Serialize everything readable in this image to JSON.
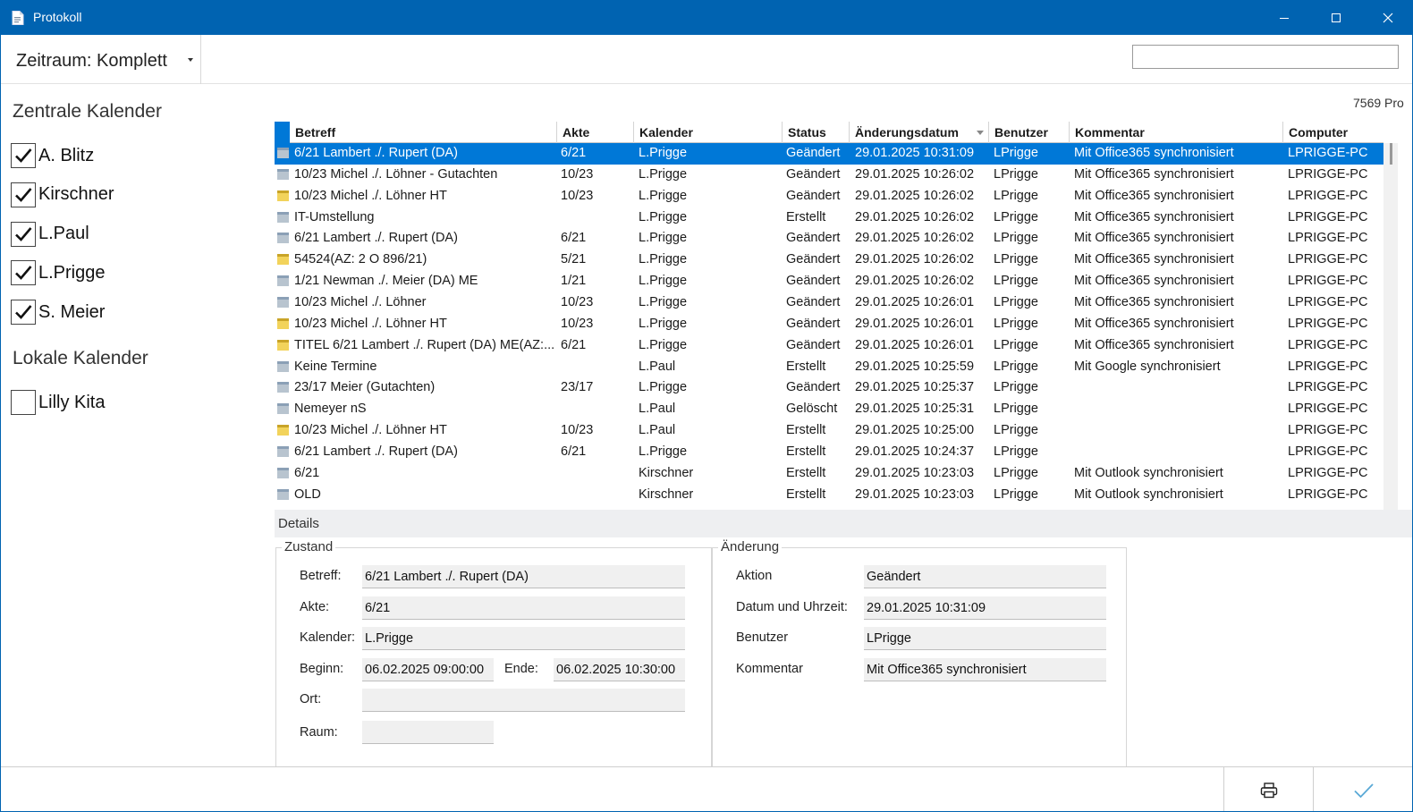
{
  "window": {
    "title": "Protokoll"
  },
  "toolbar": {
    "zeitraum_label": "Zeitraum: Komplett",
    "search_value": "",
    "search_placeholder": ""
  },
  "sidebar": {
    "central_title": "Zentrale Kalender",
    "central": [
      {
        "label": "A. Blitz",
        "checked": true
      },
      {
        "label": "Kirschner",
        "checked": true
      },
      {
        "label": "L.Paul",
        "checked": true
      },
      {
        "label": "L.Prigge",
        "checked": true
      },
      {
        "label": "S. Meier",
        "checked": true
      }
    ],
    "local_title": "Lokale Kalender",
    "local": [
      {
        "label": "Lilly Kita",
        "checked": false
      }
    ]
  },
  "grid": {
    "count_text": "7569 Pro",
    "columns": [
      "Betreff",
      "Akte",
      "Kalender",
      "Status",
      "Änderungsdatum",
      "Benutzer",
      "Kommentar",
      "Computer"
    ],
    "sorted_column": "Änderungsdatum",
    "rows": [
      {
        "icon": "calendar-gray-icon",
        "betreff": "6/21 Lambert ./. Rupert (DA)",
        "akte": "6/21",
        "kalender": "L.Prigge",
        "status": "Geändert",
        "datum": "29.01.2025 10:31:09",
        "benutzer": "LPrigge",
        "kommentar": "Mit Office365 synchronisiert",
        "computer": "LPRIGGE-PC",
        "selected": true
      },
      {
        "icon": "calendar-gray-icon",
        "betreff": "10/23 Michel ./. Löhner - Gutachten",
        "akte": "10/23",
        "kalender": "L.Prigge",
        "status": "Geändert",
        "datum": "29.01.2025 10:26:02",
        "benutzer": "LPrigge",
        "kommentar": "Mit Office365 synchronisiert",
        "computer": "LPRIGGE-PC"
      },
      {
        "icon": "calendar-yellow-icon",
        "betreff": "10/23 Michel ./. Löhner HT",
        "akte": "10/23",
        "kalender": "L.Prigge",
        "status": "Geändert",
        "datum": "29.01.2025 10:26:02",
        "benutzer": "LPrigge",
        "kommentar": "Mit Office365 synchronisiert",
        "computer": "LPRIGGE-PC"
      },
      {
        "icon": "calendar-gray-icon",
        "betreff": "IT-Umstellung",
        "akte": "",
        "kalender": "L.Prigge",
        "status": "Erstellt",
        "datum": "29.01.2025 10:26:02",
        "benutzer": "LPrigge",
        "kommentar": "Mit Office365 synchronisiert",
        "computer": "LPRIGGE-PC"
      },
      {
        "icon": "calendar-gray-icon",
        "betreff": "6/21 Lambert ./. Rupert (DA)",
        "akte": "6/21",
        "kalender": "L.Prigge",
        "status": "Geändert",
        "datum": "29.01.2025 10:26:02",
        "benutzer": "LPrigge",
        "kommentar": "Mit Office365 synchronisiert",
        "computer": "LPRIGGE-PC"
      },
      {
        "icon": "calendar-yellow-icon",
        "betreff": "54524(AZ: 2 O 896/21)",
        "akte": "5/21",
        "kalender": "L.Prigge",
        "status": "Geändert",
        "datum": "29.01.2025 10:26:02",
        "benutzer": "LPrigge",
        "kommentar": "Mit Office365 synchronisiert",
        "computer": "LPRIGGE-PC"
      },
      {
        "icon": "calendar-gray-icon",
        "betreff": "1/21 Newman ./. Meier (DA) ME",
        "akte": "1/21",
        "kalender": "L.Prigge",
        "status": "Geändert",
        "datum": "29.01.2025 10:26:02",
        "benutzer": "LPrigge",
        "kommentar": "Mit Office365 synchronisiert",
        "computer": "LPRIGGE-PC"
      },
      {
        "icon": "calendar-gray-icon",
        "betreff": "10/23 Michel ./. Löhner",
        "akte": "10/23",
        "kalender": "L.Prigge",
        "status": "Geändert",
        "datum": "29.01.2025 10:26:01",
        "benutzer": "LPrigge",
        "kommentar": "Mit Office365 synchronisiert",
        "computer": "LPRIGGE-PC"
      },
      {
        "icon": "calendar-yellow-icon",
        "betreff": "10/23 Michel ./. Löhner HT",
        "akte": "10/23",
        "kalender": "L.Prigge",
        "status": "Geändert",
        "datum": "29.01.2025 10:26:01",
        "benutzer": "LPrigge",
        "kommentar": "Mit Office365 synchronisiert",
        "computer": "LPRIGGE-PC"
      },
      {
        "icon": "calendar-yellow-icon",
        "betreff": "TITEL 6/21 Lambert ./. Rupert (DA) ME(AZ:...",
        "akte": "6/21",
        "kalender": "L.Prigge",
        "status": "Geändert",
        "datum": "29.01.2025 10:26:01",
        "benutzer": "LPrigge",
        "kommentar": "Mit Office365 synchronisiert",
        "computer": "LPRIGGE-PC"
      },
      {
        "icon": "calendar-gray-icon",
        "betreff": "Keine Termine",
        "akte": "",
        "kalender": "L.Paul",
        "status": "Erstellt",
        "datum": "29.01.2025 10:25:59",
        "benutzer": "LPrigge",
        "kommentar": "Mit Google synchronisiert",
        "computer": "LPRIGGE-PC"
      },
      {
        "icon": "calendar-gray-icon",
        "betreff": "23/17 Meier (Gutachten)",
        "akte": "23/17",
        "kalender": "L.Prigge",
        "status": "Geändert",
        "datum": "29.01.2025 10:25:37",
        "benutzer": "LPrigge",
        "kommentar": "",
        "computer": "LPRIGGE-PC"
      },
      {
        "icon": "calendar-gray-icon",
        "betreff": "Nemeyer nS",
        "akte": "",
        "kalender": "L.Paul",
        "status": "Gelöscht",
        "datum": "29.01.2025 10:25:31",
        "benutzer": "LPrigge",
        "kommentar": "",
        "computer": "LPRIGGE-PC"
      },
      {
        "icon": "calendar-yellow-icon",
        "betreff": "10/23 Michel ./. Löhner HT",
        "akte": "10/23",
        "kalender": "L.Paul",
        "status": "Erstellt",
        "datum": "29.01.2025 10:25:00",
        "benutzer": "LPrigge",
        "kommentar": "",
        "computer": "LPRIGGE-PC"
      },
      {
        "icon": "calendar-gray-icon",
        "betreff": "6/21 Lambert ./. Rupert (DA)",
        "akte": "6/21",
        "kalender": "L.Prigge",
        "status": "Erstellt",
        "datum": "29.01.2025 10:24:37",
        "benutzer": "LPrigge",
        "kommentar": "",
        "computer": "LPRIGGE-PC"
      },
      {
        "icon": "calendar-gray-icon",
        "betreff": "6/21",
        "akte": "",
        "kalender": "Kirschner",
        "status": "Erstellt",
        "datum": "29.01.2025 10:23:03",
        "benutzer": "LPrigge",
        "kommentar": "Mit Outlook synchronisiert",
        "computer": "LPRIGGE-PC"
      },
      {
        "icon": "calendar-gray-icon",
        "betreff": "OLD",
        "akte": "",
        "kalender": "Kirschner",
        "status": "Erstellt",
        "datum": "29.01.2025 10:23:03",
        "benutzer": "LPrigge",
        "kommentar": "Mit Outlook synchronisiert",
        "computer": "LPRIGGE-PC"
      }
    ]
  },
  "details": {
    "bar_label": "Details",
    "zustand": {
      "title": "Zustand",
      "betreff_label": "Betreff:",
      "betreff": "6/21 Lambert ./. Rupert (DA)",
      "akte_label": "Akte:",
      "akte": "6/21",
      "kalender_label": "Kalender:",
      "kalender": "L.Prigge",
      "beginn_label": "Beginn:",
      "beginn": "06.02.2025 09:00:00",
      "ende_label": "Ende:",
      "ende": "06.02.2025 10:30:00",
      "ort_label": "Ort:",
      "ort": "",
      "raum_label": "Raum:",
      "raum": ""
    },
    "aenderung": {
      "title": "Änderung",
      "aktion_label": "Aktion",
      "aktion": "Geändert",
      "datum_label": "Datum und Uhrzeit:",
      "datum": "29.01.2025 10:31:09",
      "benutzer_label": "Benutzer",
      "benutzer": "LPrigge",
      "kommentar_label": "Kommentar",
      "kommentar": "Mit Office365 synchronisiert"
    }
  },
  "colors": {
    "accent": "#0063b1",
    "selection": "#0078d7",
    "ok_check": "#5aa9d6"
  }
}
